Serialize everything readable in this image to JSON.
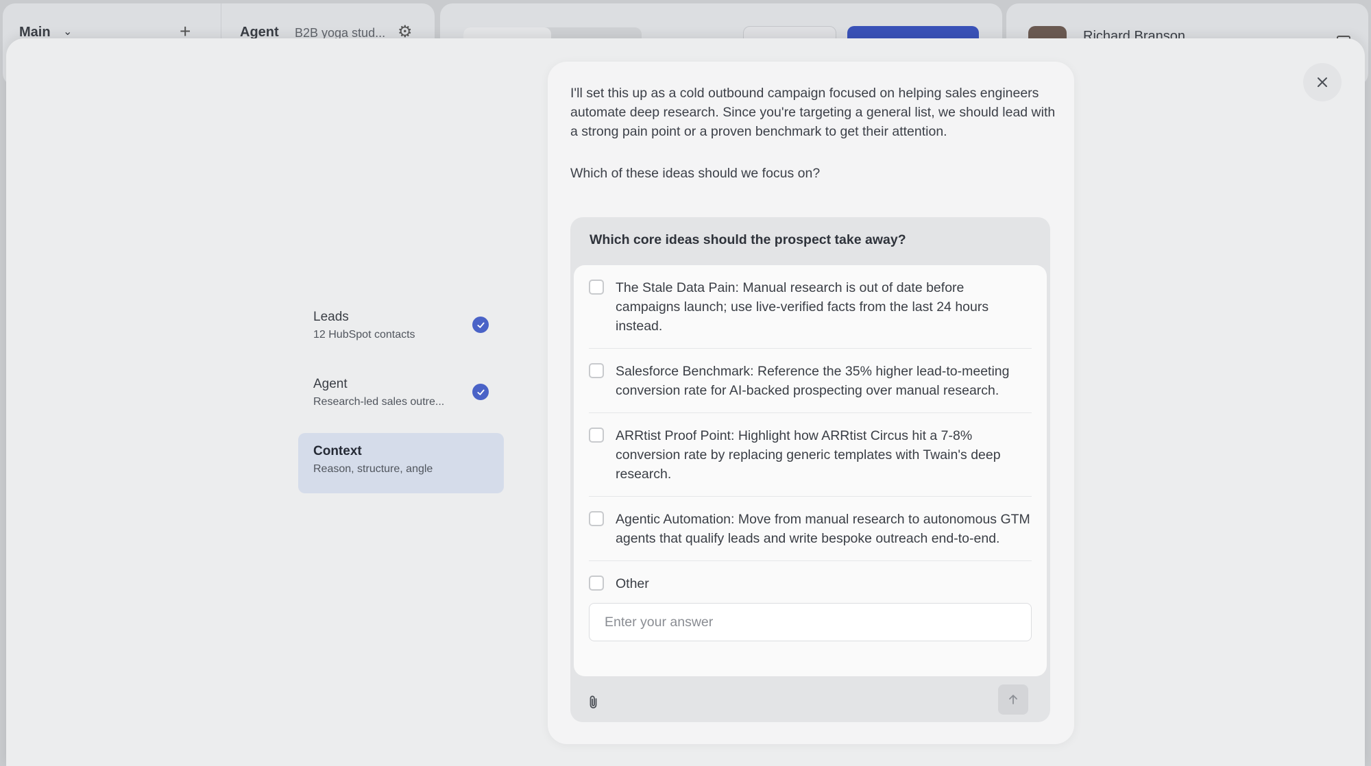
{
  "background": {
    "nav_title": "Main",
    "agent_label": "Agent",
    "agent_subtitle": "B2B yoga stud...",
    "user_name": "Richard Branson",
    "primary_color": "#3a52b8"
  },
  "modal": {
    "close_icon": "close-icon",
    "steps": [
      {
        "title": "Leads",
        "subtitle": "12 HubSpot contacts",
        "completed": true
      },
      {
        "title": "Agent",
        "subtitle": "Research-led sales outre...",
        "completed": true
      },
      {
        "title": "Context",
        "subtitle": "Reason, structure, angle",
        "completed": false,
        "active": true
      }
    ],
    "chat": {
      "message": "I'll set this up as a cold outbound campaign focused on helping sales engineers automate deep research. Since you're targeting a general list, we should lead with a strong pain point or a proven benchmark to get their attention.",
      "question": "Which of these ideas should we focus on?",
      "question_box": {
        "title": "Which core ideas should the prospect take away?",
        "options": [
          "The Stale Data Pain: Manual research is out of date before campaigns launch; use live-verified facts from the last 24 hours instead.",
          "Salesforce Benchmark: Reference the 35% higher lead-to-meeting conversion rate for AI-backed prospecting over manual research.",
          "ARRtist Proof Point: Highlight how ARRtist Circus hit a 7-8% conversion rate by replacing generic templates with Twain's deep research.",
          "Agentic Automation: Move from manual research to autonomous GTM agents that qualify leads and write bespoke outreach end-to-end.",
          "Other"
        ],
        "answer_placeholder": "Enter your answer",
        "answer_value": ""
      },
      "attach_icon": "paperclip-icon",
      "send_icon": "arrow-up-icon"
    }
  },
  "colors": {
    "check_blue": "#4a63c7",
    "active_step_bg": "#d5dcea"
  }
}
